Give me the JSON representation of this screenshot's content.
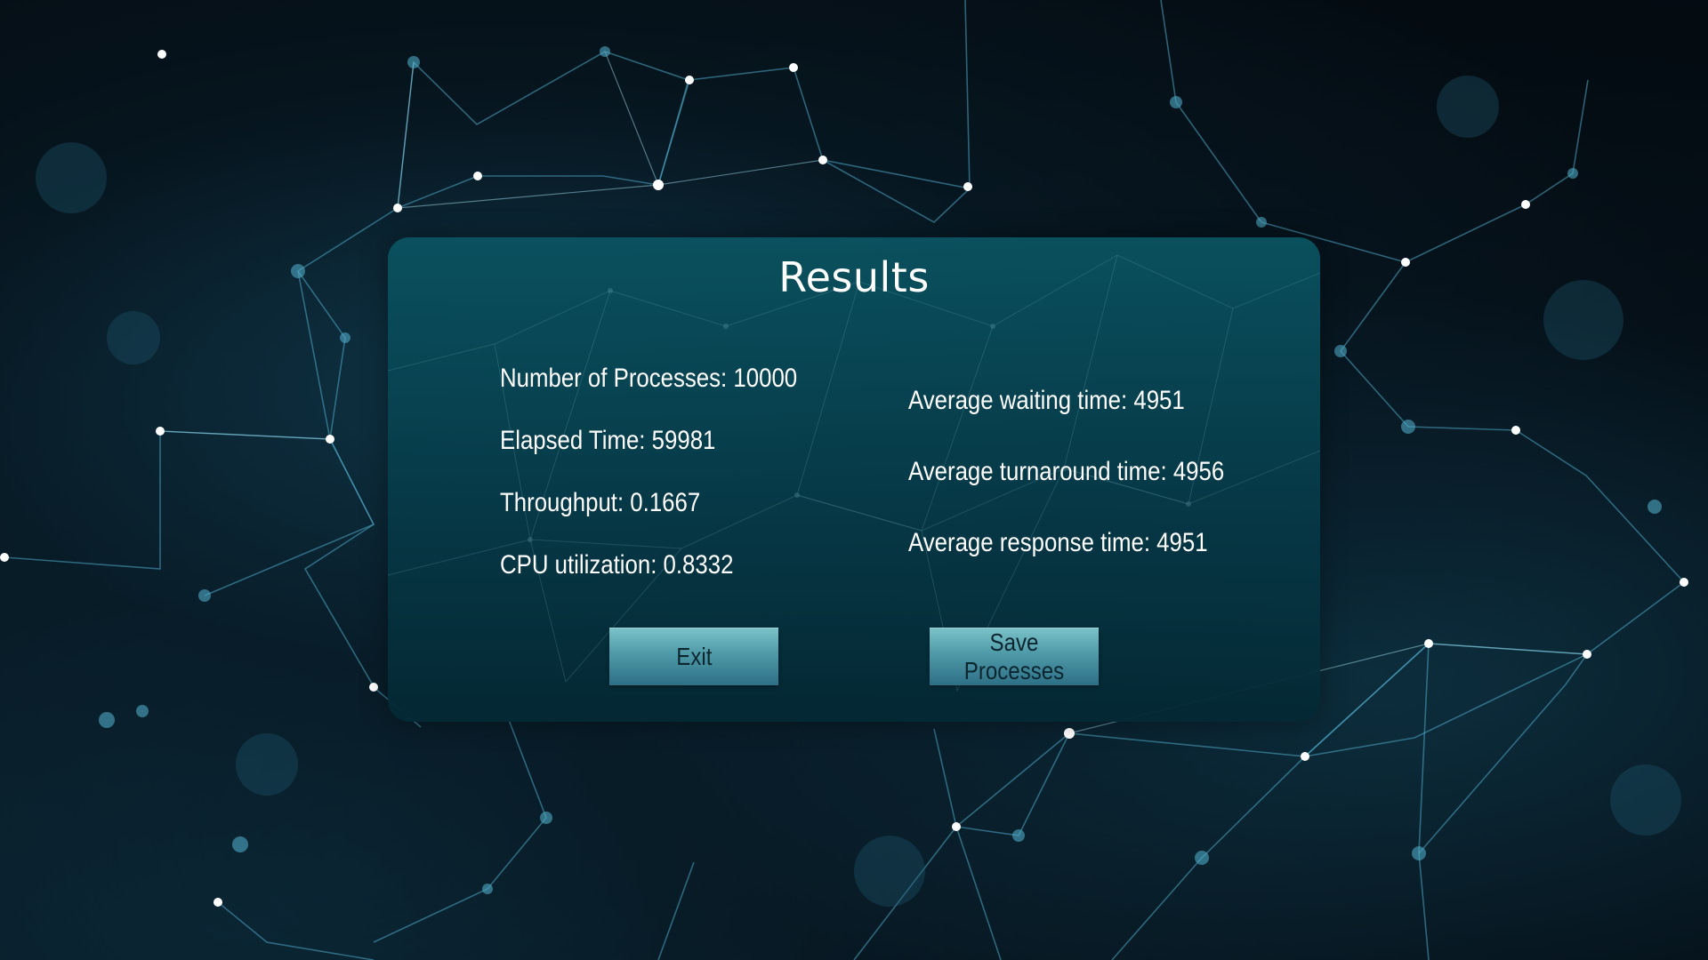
{
  "results": {
    "title": "Results",
    "stats_left": [
      {
        "label": "Number of Processes: 10000"
      },
      {
        "label": "Elapsed Time: 59981"
      },
      {
        "label": "Throughput: 0.1667"
      },
      {
        "label": "CPU utilization: 0.8332"
      }
    ],
    "stats_right": [
      {
        "label": "Average waiting time: 4951"
      },
      {
        "label": "Average turnaround time: 4956"
      },
      {
        "label": "Average response time: 4951"
      }
    ],
    "buttons": {
      "exit": "Exit",
      "save": "Save Processes"
    }
  },
  "colors": {
    "background": "#040b11",
    "panel": "#0a5260",
    "network_line": "#4fa8c4",
    "button": "#4f9aa8",
    "text": "#ffffff"
  }
}
